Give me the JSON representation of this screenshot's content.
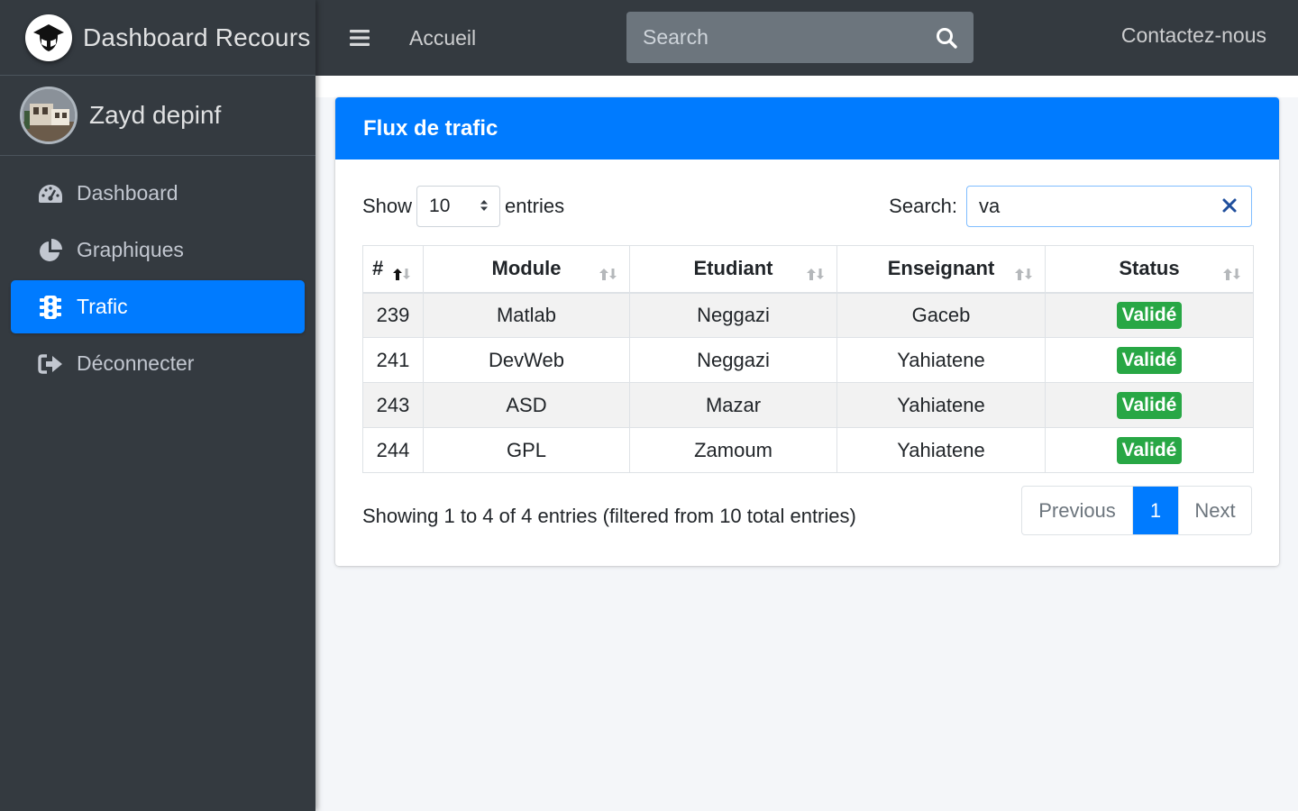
{
  "brand": {
    "title": "Dashboard Recours"
  },
  "user": {
    "name": "Zayd depinf"
  },
  "sidebar": {
    "items": [
      {
        "label": "Dashboard",
        "icon": "tachometer-icon"
      },
      {
        "label": "Graphiques",
        "icon": "pie-chart-icon"
      },
      {
        "label": "Trafic",
        "icon": "traffic-light-icon",
        "active": true
      },
      {
        "label": "Déconnecter",
        "icon": "sign-out-icon"
      }
    ]
  },
  "topbar": {
    "home_link": "Accueil",
    "search_placeholder": "Search",
    "contact_link": "Contactez-nous"
  },
  "card": {
    "title": "Flux de trafic",
    "length": {
      "show_label": "Show",
      "value": "10",
      "entries_label": "entries"
    },
    "filter": {
      "label": "Search:",
      "value": "va"
    },
    "table": {
      "columns": [
        "#",
        "Module",
        "Etudiant",
        "Enseignant",
        "Status"
      ],
      "rows": [
        {
          "id": "239",
          "module": "Matlab",
          "etudiant": "Neggazi",
          "enseignant": "Gaceb",
          "status": "Validé"
        },
        {
          "id": "241",
          "module": "DevWeb",
          "etudiant": "Neggazi",
          "enseignant": "Yahiatene",
          "status": "Validé"
        },
        {
          "id": "243",
          "module": "ASD",
          "etudiant": "Mazar",
          "enseignant": "Yahiatene",
          "status": "Validé"
        },
        {
          "id": "244",
          "module": "GPL",
          "etudiant": "Zamoum",
          "enseignant": "Yahiatene",
          "status": "Validé"
        }
      ]
    },
    "info": "Showing 1 to 4 of 4 entries (filtered from 10 total entries)",
    "pagination": {
      "previous": "Previous",
      "current": "1",
      "next": "Next"
    }
  },
  "colors": {
    "primary": "#007bff",
    "sidebar": "#343a40",
    "success": "#28a745"
  }
}
